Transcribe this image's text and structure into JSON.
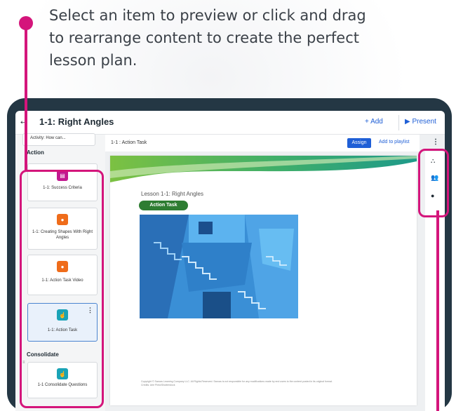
{
  "intro": {
    "line1": "Select an item to preview or click and drag",
    "line2": "to rearrange content to create the perfect",
    "line3": "lesson plan."
  },
  "app": {
    "title": "1-1: Right Angles",
    "add_label": "+ Add",
    "present_label": "▶ Present"
  },
  "sidebar": {
    "prev_card": "Activity: How can...",
    "section_action": "Action",
    "section_consolidate": "Consolidate",
    "items": [
      {
        "label": "1-1: Success Criteria",
        "icon": "document-icon",
        "color": "#c2188f"
      },
      {
        "label": "1-1: Creating Shapes With Right Angles",
        "icon": "play-icon",
        "color": "#ef6c1a"
      },
      {
        "label": "1-1: Action Task Video",
        "icon": "play-icon",
        "color": "#ef6c1a"
      },
      {
        "label": "1-1: Action Task",
        "icon": "hand-pointer-icon",
        "color": "#1aa3b6"
      },
      {
        "label": "1-1 Consolidate Questions",
        "icon": "hand-pointer-icon",
        "color": "#1aa3b6"
      }
    ]
  },
  "main": {
    "crumb": "1-1 : Action Task",
    "assign_label": "Assign",
    "playlist_label": "Add to playlist",
    "doc_heading": "Lesson 1-1: Right Angles",
    "pill_label": "Action Task",
    "footer_line1": "Copyright © Savvas Learning Company LLC. All Rights Reserved. Savvas is not responsible for any modifications made by end users to the content posted in its original format.",
    "footer_line2": "Credits: Arie Pinto/Shutterstock"
  },
  "colors": {
    "accent": "#d4157b",
    "frame": "#243744",
    "primary": "#1f5fd6",
    "pill": "#2e7d32"
  }
}
